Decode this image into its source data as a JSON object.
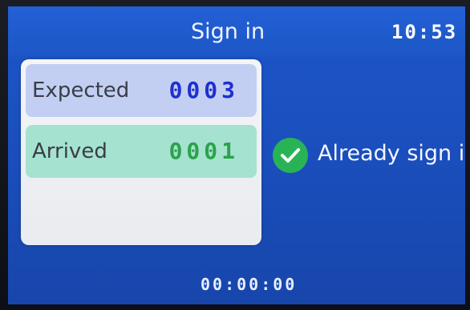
{
  "header": {
    "title": "Sign in",
    "clock": "10:53"
  },
  "counts": {
    "expected_label": "Expected",
    "expected_value": "0003",
    "arrived_label": "Arrived",
    "arrived_value": "0001"
  },
  "status": {
    "icon": "check-circle-icon",
    "text": "Already sign in",
    "icon_color": "#28b456"
  },
  "footer": {
    "timer": "00:00:00"
  },
  "colors": {
    "screen_background": "#1b4fbe",
    "expected_row": "#c2cff2",
    "arrived_row": "#a5e2d0",
    "expected_value": "#1f2fd0",
    "arrived_value": "#2aa34a"
  }
}
